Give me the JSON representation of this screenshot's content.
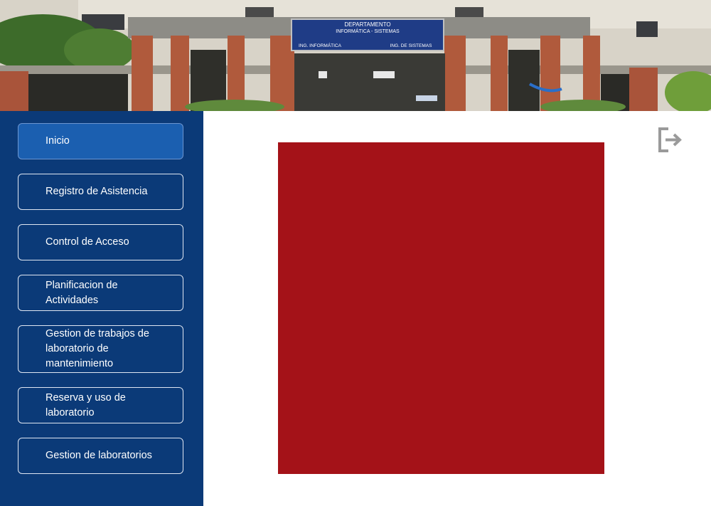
{
  "banner": {
    "sign_title": "DEPARTAMENTO",
    "sign_subtitle": "INFORMÁTICA - SISTEMAS",
    "sign_left": "ING. INFORMÁTICA",
    "sign_right": "ING. DE SISTEMAS"
  },
  "sidebar": {
    "items": [
      {
        "label": "Inicio",
        "active": true
      },
      {
        "label": "Registro de Asistencia",
        "active": false
      },
      {
        "label": "Control de Acceso",
        "active": false
      },
      {
        "label": "Planificacion de Actividades",
        "active": false
      },
      {
        "label": "Gestion de trabajos de laboratorio de mantenimiento",
        "active": false
      },
      {
        "label": "Reserva y uso de laboratorio",
        "active": false
      },
      {
        "label": "Gestion de laboratorios",
        "active": false
      }
    ]
  },
  "main": {
    "panel_color": "#a41218",
    "logout_icon": "logout-icon"
  },
  "colors": {
    "sidebar_bg": "#0b3a78",
    "active_item": "#1b5fb0",
    "logout_icon": "#9a9a9a"
  }
}
